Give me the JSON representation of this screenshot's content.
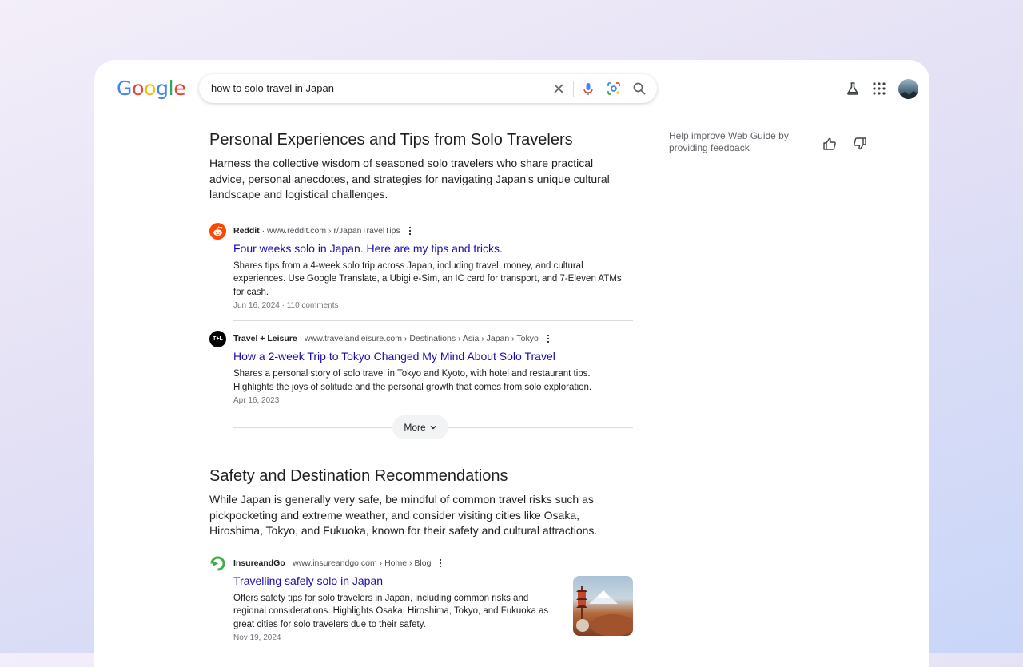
{
  "search": {
    "query": "how to solo travel in Japan",
    "logo_text": "Google"
  },
  "feedback": {
    "text": "Help improve Web Guide by providing feedback"
  },
  "sections": [
    {
      "title": "Personal Experiences and Tips from Solo Travelers",
      "description": "Harness the collective wisdom of seasoned solo travelers who share practical advice, personal anecdotes, and strategies for navigating Japan's unique cultural landscape and logistical challenges.",
      "results": [
        {
          "source": "Reddit",
          "url": "www.reddit.com › r/JapanTravelTips",
          "title": "Four weeks solo in Japan. Here are my tips and tricks.",
          "snippet": "Shares tips from a 4-week solo trip across Japan, including travel, money, and cultural experiences. Use Google Translate, a Ubigi e-Sim, an IC card for transport, and 7-Eleven ATMs for cash.",
          "date": "Jun 16, 2024 · 110 comments"
        },
        {
          "source": "Travel + Leisure",
          "url": "www.travelandleisure.com › Destinations › Asia › Japan › Tokyo",
          "title": "How a 2-week Trip to Tokyo Changed My Mind About Solo Travel",
          "snippet": "Shares a personal story of solo travel in Tokyo and Kyoto, with hotel and restaurant tips. Highlights the joys of solitude and the personal growth that comes from solo exploration.",
          "date": "Apr 16, 2023",
          "favicon_text": "T+L"
        }
      ],
      "more_label": "More"
    },
    {
      "title": "Safety and Destination Recommendations",
      "description": "While Japan is generally very safe, be mindful of common travel risks such as pickpocketing and extreme weather, and consider visiting cities like Osaka, Hiroshima, Tokyo, and Fukuoka, known for their safety and cultural attractions.",
      "results": [
        {
          "source": "InsureandGo",
          "url": "www.insureandgo.com › Home › Blog",
          "title": "Travelling safely solo in Japan",
          "snippet": "Offers safety tips for solo travelers in Japan, including common risks and regional considerations. Highlights Osaka, Hiroshima, Tokyo, and Fukuoka as great cities for solo travelers due to their safety.",
          "date": "Nov 19, 2024"
        }
      ]
    }
  ],
  "colors": {
    "link": "#1a0dab",
    "reddit": "#FF4500",
    "insureandgo": "#3fae49"
  }
}
